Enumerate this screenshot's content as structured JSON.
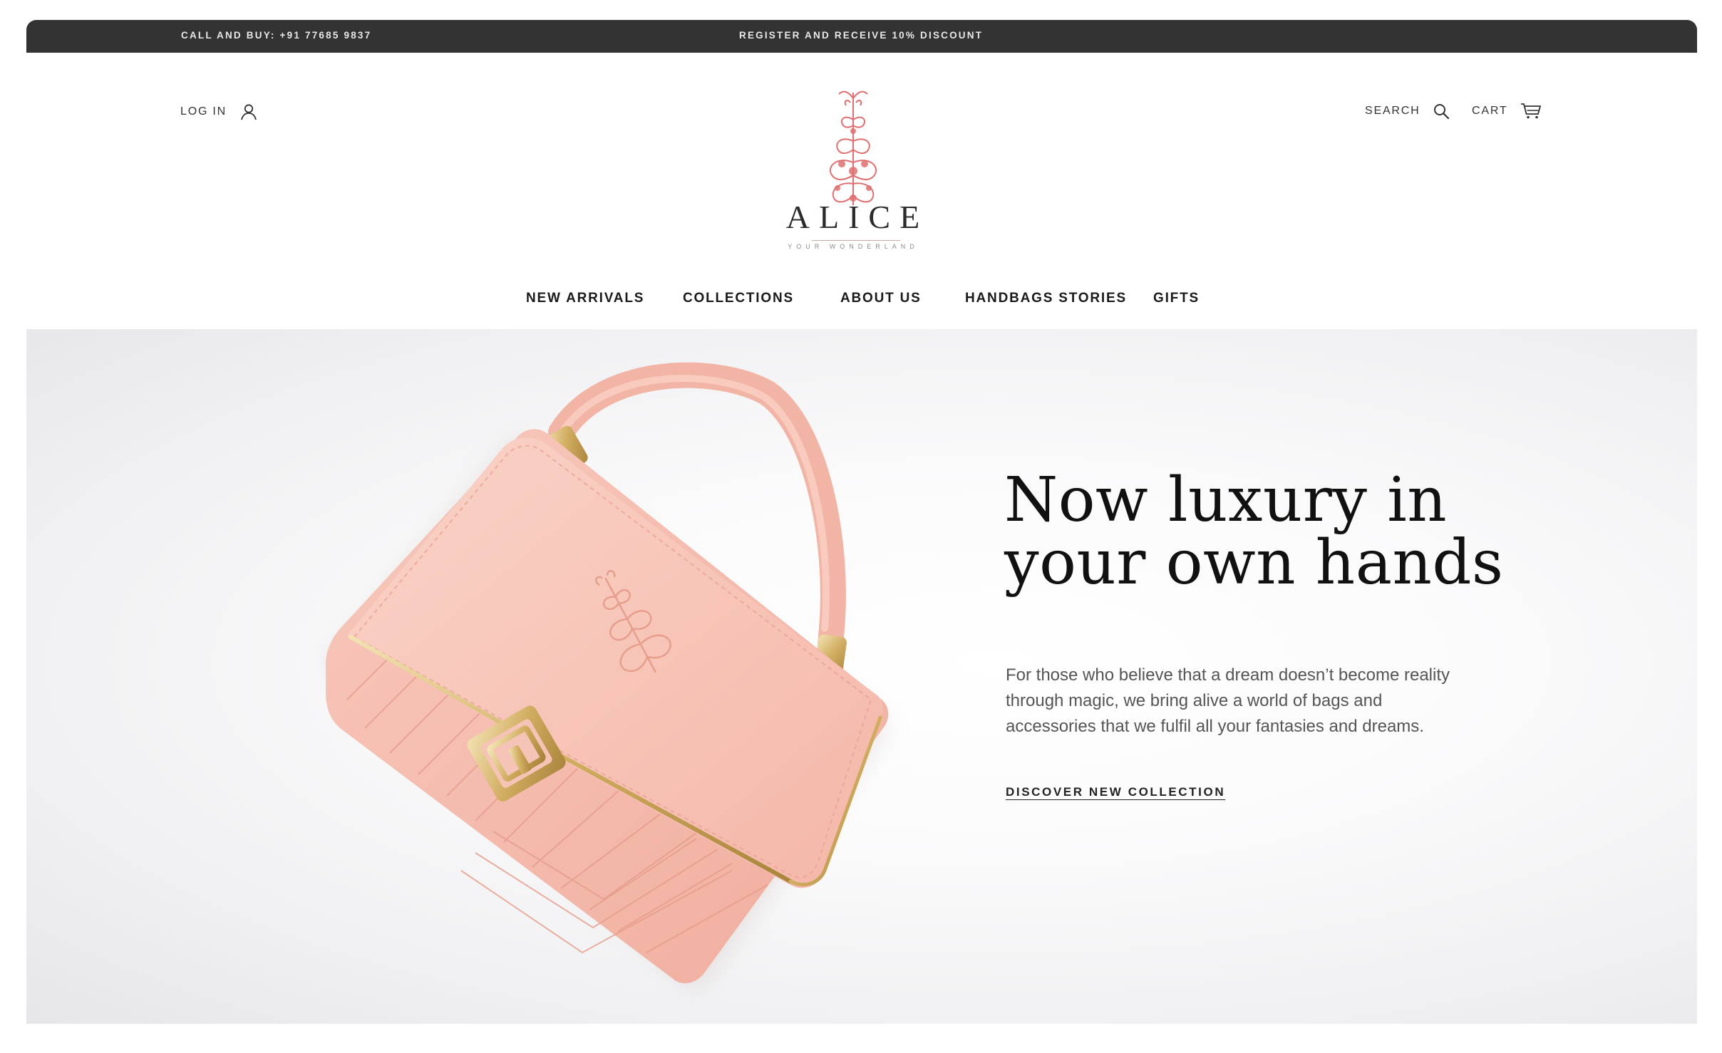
{
  "topbar": {
    "phone": "CALL AND BUY: +91 77685 9837",
    "promo": "REGISTER AND RECEIVE 10% DISCOUNT"
  },
  "header": {
    "login_label": "LOG IN",
    "login_icon": "user-icon",
    "search_label": "SEARCH",
    "search_icon": "search-icon",
    "cart_label": "CART",
    "cart_icon": "cart-icon"
  },
  "logo": {
    "brand": "ALICE",
    "tagline": "YOUR WONDERLAND",
    "accent": "#e06f6f"
  },
  "nav": {
    "items": [
      {
        "label": "NEW ARRIVALS"
      },
      {
        "label": "COLLECTIONS"
      },
      {
        "label": "ABOUT US"
      },
      {
        "label": "HANDBAGS STORIES"
      },
      {
        "label": "GIFTS"
      }
    ]
  },
  "hero": {
    "headline_line1": "Now luxury in",
    "headline_line2": "your own hands",
    "description": "For those who believe that a dream doesn’t become reality through magic, we bring alive a world of bags and accessories that we fulfil all your fantasies and dreams.",
    "cta": "DISCOVER NEW COLLECTION",
    "image": "pink-handbag-image",
    "bag_color": "#f6bfb1",
    "hardware_color": "#d8b873"
  },
  "colors": {
    "topbar_bg": "#333333",
    "text_dark": "#111111"
  }
}
